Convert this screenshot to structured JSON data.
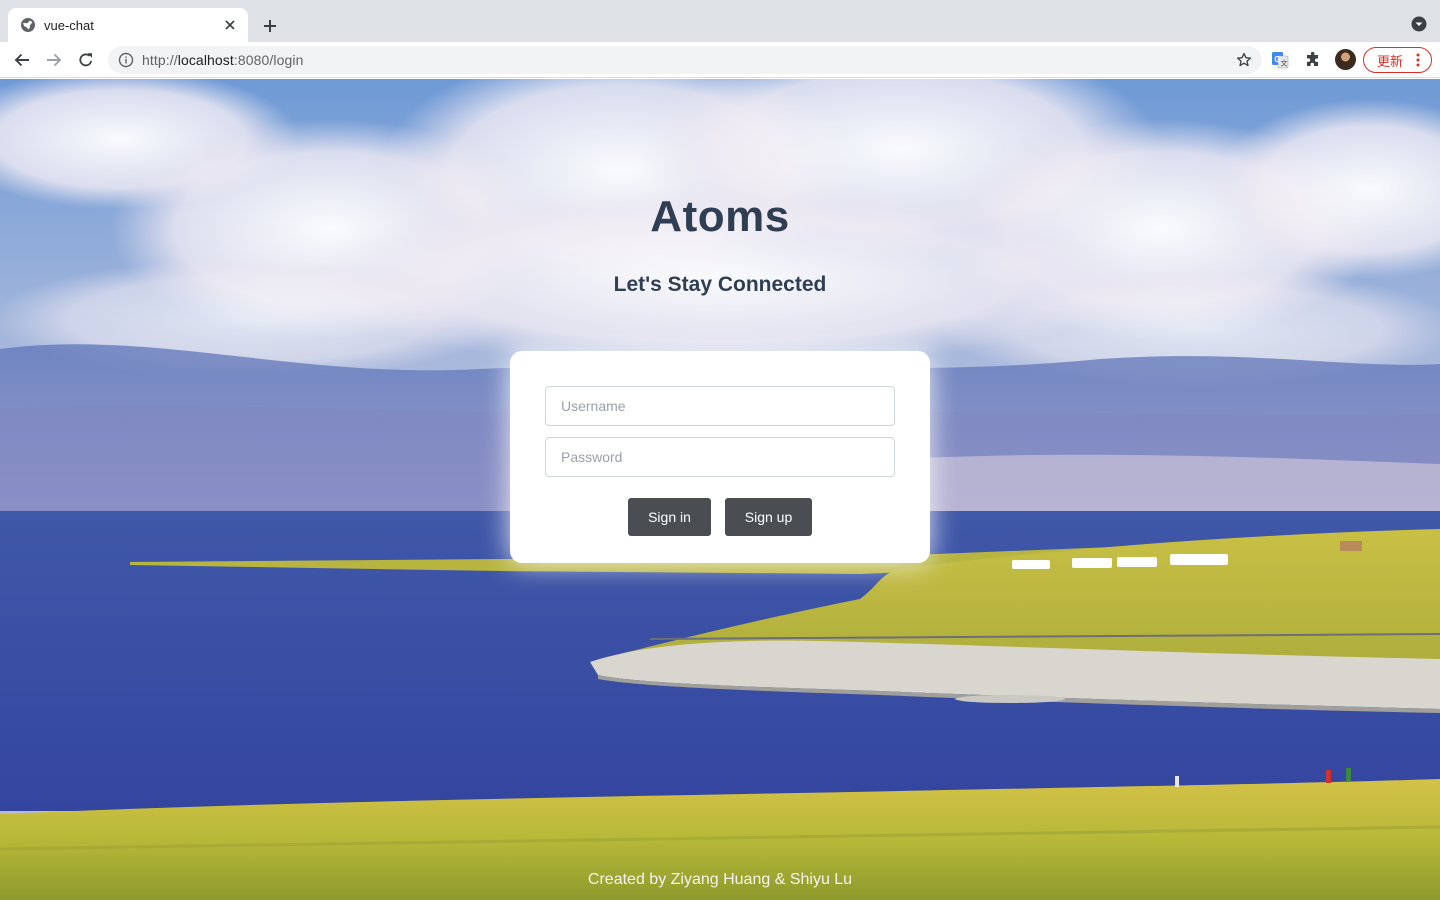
{
  "browser": {
    "tab": {
      "title": "vue-chat",
      "favicon": "globe-icon"
    },
    "url": {
      "scheme": "http://",
      "host": "localhost",
      "rest": ":8080/login"
    },
    "icons": [
      "back-icon",
      "forward-icon",
      "reload-icon",
      "info-icon",
      "star-icon",
      "translate-icon",
      "puzzle-icon",
      "close-icon",
      "plus-icon",
      "chevron-down-icon",
      "kebab-icon"
    ],
    "update_button": "更新",
    "accent": "#d93025"
  },
  "page": {
    "title": "Atoms",
    "subtitle": "Let's Stay Connected",
    "form": {
      "username_placeholder": "Username",
      "password_placeholder": "Password",
      "username_value": "",
      "password_value": "",
      "signin_label": "Sign in",
      "signup_label": "Sign up"
    },
    "footer": "Created by Ziyang Huang & Shiyu Lu",
    "colors": {
      "title": "#2f3e52",
      "button": "#4a4e53"
    }
  }
}
